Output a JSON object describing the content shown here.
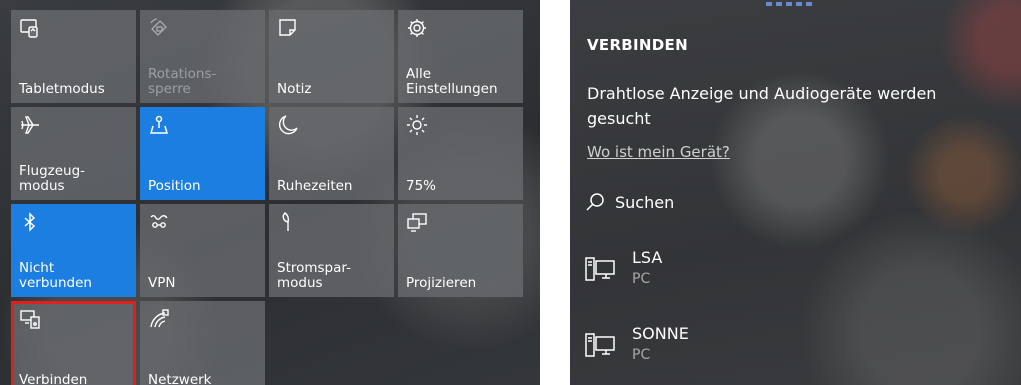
{
  "action_center": {
    "tiles": [
      {
        "label": "Tabletmodus",
        "icon": "tablet-mode-icon",
        "state": "normal"
      },
      {
        "label": "Rotations-\nsperre",
        "icon": "rotation-lock-icon",
        "state": "disabled"
      },
      {
        "label": "Notiz",
        "icon": "note-icon",
        "state": "normal"
      },
      {
        "label": "Alle\nEinstellungen",
        "icon": "gear-icon",
        "state": "normal"
      },
      {
        "label": "Flugzeug-\nmodus",
        "icon": "airplane-icon",
        "state": "normal"
      },
      {
        "label": "Position",
        "icon": "location-icon",
        "state": "active"
      },
      {
        "label": "Ruhezeiten",
        "icon": "moon-icon",
        "state": "normal"
      },
      {
        "label": "75%",
        "icon": "brightness-icon",
        "state": "normal"
      },
      {
        "label": "Nicht\nverbunden",
        "icon": "bluetooth-icon",
        "state": "active"
      },
      {
        "label": "VPN",
        "icon": "vpn-icon",
        "state": "normal"
      },
      {
        "label": "Stromspar-\nmodus",
        "icon": "battery-saver-icon",
        "state": "normal"
      },
      {
        "label": "Projizieren",
        "icon": "project-icon",
        "state": "normal"
      },
      {
        "label": "Verbinden",
        "icon": "connect-icon",
        "state": "highlighted"
      },
      {
        "label": "Netzwerk",
        "icon": "network-icon",
        "state": "normal"
      }
    ]
  },
  "connect_panel": {
    "title": "VERBINDEN",
    "status": "Drahtlose Anzeige und Audiogeräte werden gesucht",
    "help_link": "Wo ist mein Gerät?",
    "search_label": "Suchen",
    "devices": [
      {
        "name": "LSA",
        "type": "PC"
      },
      {
        "name": "SONNE",
        "type": "PC"
      }
    ]
  },
  "colors": {
    "accent": "#1c7ee0",
    "highlight_border": "#e0201f",
    "tile_bg": "#696c70"
  }
}
